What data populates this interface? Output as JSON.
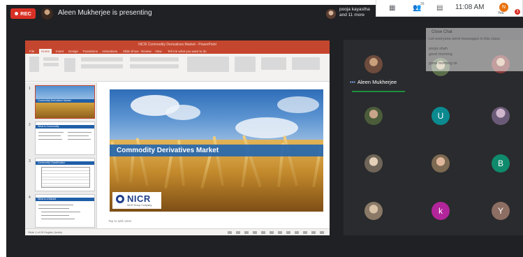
{
  "top_bar": {
    "rec_label": "REC",
    "presenting_text": "Aleen Mukherjee is presenting",
    "viewer_name_line1": "pooja kayastha",
    "viewer_name_line2": "and 11 more",
    "people_count": "26",
    "clock": "11:08 AM",
    "you_initial": "N",
    "you_label": "You",
    "notification_count": "3"
  },
  "chat_overlay": {
    "header": "Close Chat",
    "messages": [
      "Let everyone send messages in this class",
      "pooja shah",
      "good morning",
      "good morning sir"
    ]
  },
  "presentation": {
    "window_title": "NICR Commodity Derivatives Market - PowerPoint",
    "ribbon_tabs": [
      "File",
      "Home",
      "Insert",
      "Design",
      "Transitions",
      "Animations",
      "Slide Show",
      "Review",
      "View",
      "Tell me what you want to do"
    ],
    "slide_title": "Commodity Derivatives Market",
    "logo_text": "NICR",
    "logo_subtext": "NICR Group Company",
    "thumbnail_titles": [
      "Commodity Derivatives Market",
      "What is Commodity",
      "Commodity Classification",
      "What is a Market"
    ],
    "notes_placeholder": "Tap to add notes",
    "status_text": "Slide 1 of 29   English (India)"
  },
  "participants": {
    "active_speaker": "Aleen Mukherjee",
    "tiles": [
      {
        "type": "photo",
        "color": "#6d4c3d"
      },
      {
        "type": "photo",
        "color": "#5a6e4a"
      },
      {
        "type": "photo",
        "color": "#8a3b3b"
      },
      {
        "type": "photo",
        "color": "#4b5d3a"
      },
      {
        "type": "initial",
        "letter": "U",
        "color": "#0b8a8f"
      },
      {
        "type": "photo",
        "color": "#6a5a78"
      },
      {
        "type": "photo",
        "color": "#6f6558"
      },
      {
        "type": "photo",
        "color": "#7d6a52"
      },
      {
        "type": "initial",
        "letter": "B",
        "color": "#0f8a6c"
      },
      {
        "type": "photo",
        "color": "#8a7966"
      },
      {
        "type": "initial",
        "letter": "k",
        "color": "#b3259a"
      },
      {
        "type": "initial",
        "letter": "Y",
        "color": "#8d6e63"
      }
    ]
  },
  "colors": {
    "meet_background": "#202124",
    "rec_red": "#d93025",
    "ppt_accent": "#c5462e",
    "slide_band": "#2667af",
    "speaking_green": "#1e8e3e"
  }
}
